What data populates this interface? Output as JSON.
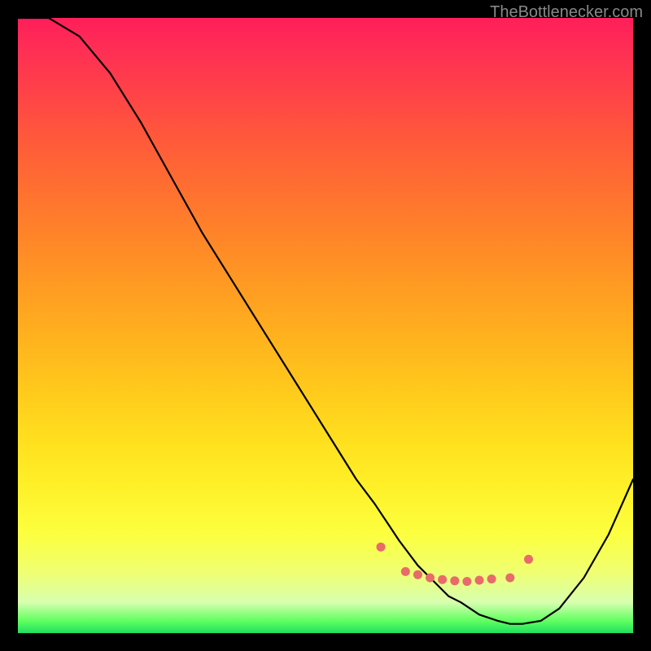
{
  "watermark": "TheBottlenecker.com",
  "chart_data": {
    "type": "line",
    "title": "",
    "xlabel": "",
    "ylabel": "",
    "xlim": [
      0,
      100
    ],
    "ylim": [
      0,
      100
    ],
    "series": [
      {
        "name": "curve",
        "x": [
          0,
          5,
          10,
          15,
          20,
          25,
          30,
          35,
          40,
          45,
          50,
          55,
          58,
          60,
          62,
          65,
          68,
          70,
          72,
          75,
          78,
          80,
          82,
          85,
          88,
          92,
          96,
          100
        ],
        "values": [
          100,
          100,
          97,
          91,
          83,
          74,
          65,
          57,
          49,
          41,
          33,
          25,
          21,
          18,
          15,
          11,
          8,
          6,
          5,
          3,
          2,
          1.5,
          1.5,
          2,
          4,
          9,
          16,
          25
        ]
      }
    ],
    "markers": {
      "x": [
        59,
        63,
        65,
        67,
        69,
        71,
        73,
        75,
        77,
        80,
        83
      ],
      "values": [
        14,
        10,
        9.5,
        9,
        8.7,
        8.5,
        8.4,
        8.6,
        8.8,
        9,
        12
      ],
      "color": "#e86a6a"
    },
    "gradient_stops": [
      {
        "pos": 0,
        "color": "#ff1e5a"
      },
      {
        "pos": 50,
        "color": "#ffb21e"
      },
      {
        "pos": 85,
        "color": "#fcff40"
      },
      {
        "pos": 100,
        "color": "#20e060"
      }
    ]
  }
}
